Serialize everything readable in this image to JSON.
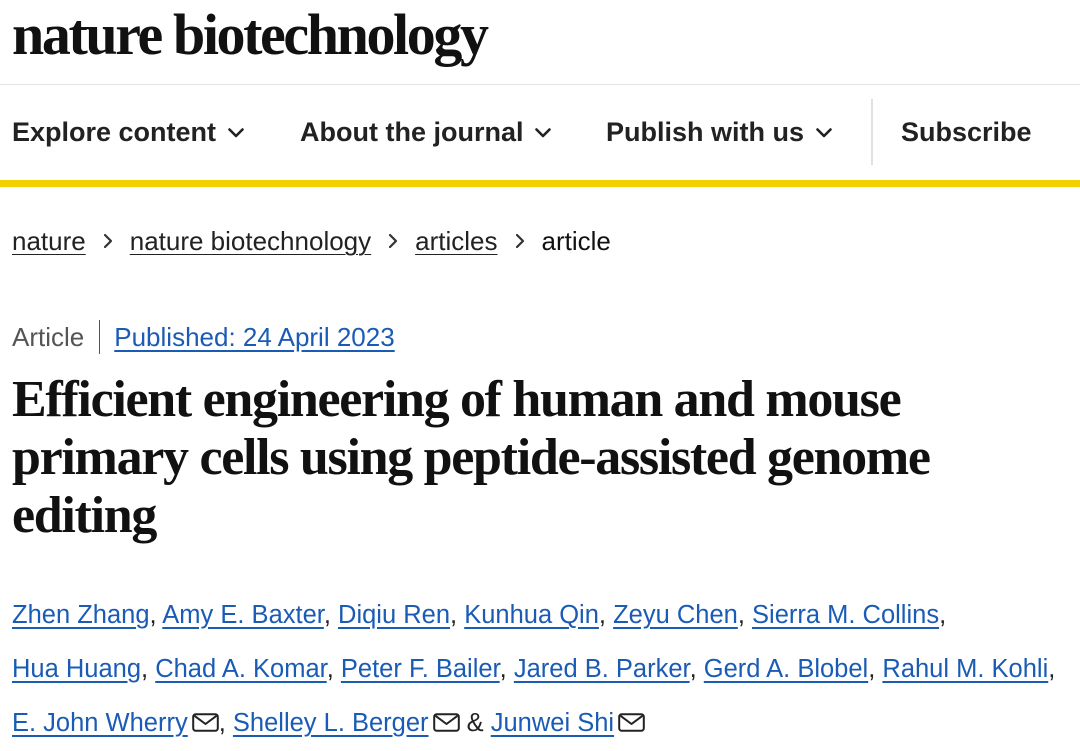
{
  "masthead": {
    "logo": "nature biotechnology"
  },
  "nav": {
    "items": [
      {
        "label": "Explore content"
      },
      {
        "label": "About the journal"
      },
      {
        "label": "Publish with us"
      }
    ],
    "subscribe": "Subscribe"
  },
  "breadcrumb": {
    "links": [
      "nature",
      "nature biotechnology",
      "articles"
    ],
    "current": "article"
  },
  "article": {
    "type": "Article",
    "published": "Published: 24 April 2023",
    "title": "Efficient engineering of human and mouse primary cells using peptide-assisted genome editing",
    "authors": [
      {
        "name": "Zhen Zhang",
        "sep": ", "
      },
      {
        "name": "Amy E. Baxter",
        "sep": ", "
      },
      {
        "name": "Diqiu Ren",
        "sep": ", "
      },
      {
        "name": "Kunhua Qin",
        "sep": ", "
      },
      {
        "name": "Zeyu Chen",
        "sep": ", "
      },
      {
        "name": "Sierra M. Collins",
        "sep": ", "
      },
      {
        "name": "Hua Huang",
        "sep": ", "
      },
      {
        "name": "Chad A. Komar",
        "sep": ", "
      },
      {
        "name": "Peter F. Bailer",
        "sep": ", "
      },
      {
        "name": "Jared B. Parker",
        "sep": ", "
      },
      {
        "name": "Gerd A. Blobel",
        "sep": ", "
      },
      {
        "name": "Rahul M. Kohli",
        "sep": ", "
      },
      {
        "name": "E. John Wherry",
        "sep": ", "
      },
      {
        "name": "Shelley L. Berger",
        "sep": " & "
      },
      {
        "name": "Junwei Shi",
        "sep": ""
      }
    ]
  },
  "colors": {
    "accent": "#f3d000",
    "link": "#1a5bb5"
  },
  "icons": {
    "chevron": "chevron-down-icon",
    "separator": "chevron-right-icon",
    "mail": "mail-icon"
  }
}
